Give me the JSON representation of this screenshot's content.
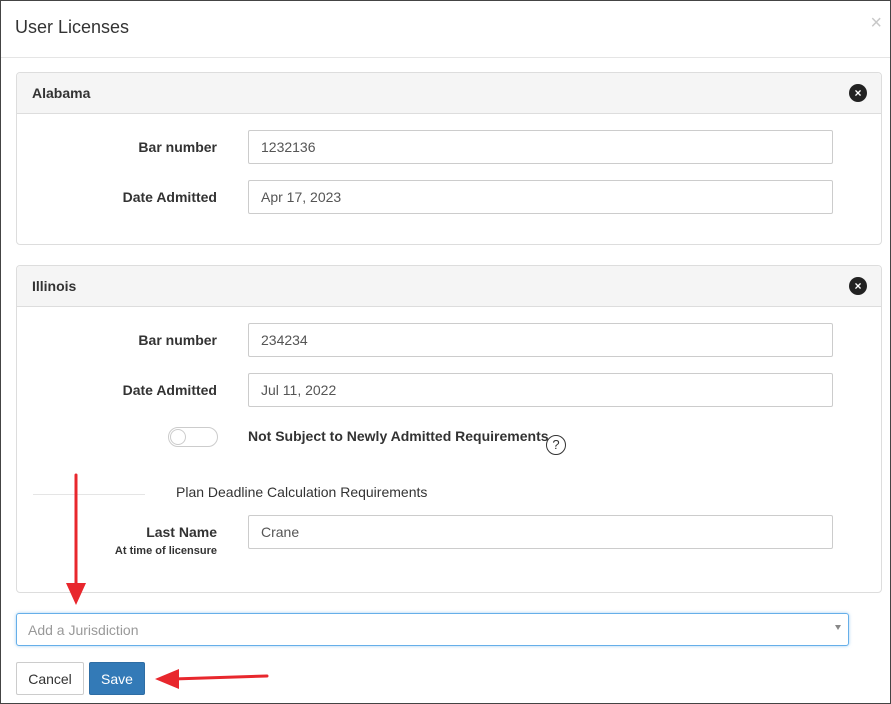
{
  "modal": {
    "title": "User Licenses",
    "close_glyph": "×"
  },
  "licenses": [
    {
      "state": "Alabama",
      "remove_glyph": "×",
      "bar_number_label": "Bar number",
      "bar_number": "1232136",
      "date_admitted_label": "Date Admitted",
      "date_admitted": "Apr 17, 2023"
    },
    {
      "state": "Illinois",
      "remove_glyph": "×",
      "bar_number_label": "Bar number",
      "bar_number": "234234",
      "date_admitted_label": "Date Admitted",
      "date_admitted": "Jul 11, 2022",
      "toggle_label": "Not Subject to Newly Admitted Requirements",
      "toggle_on": false,
      "help_glyph": "?",
      "section_title": "Plan Deadline Calculation Requirements",
      "last_name_label": "Last Name",
      "last_name_sublabel": "At time of licensure",
      "last_name": "Crane"
    }
  ],
  "jurisdiction": {
    "placeholder": "Add a Jurisdiction"
  },
  "footer": {
    "cancel_label": "Cancel",
    "save_label": "Save"
  },
  "colors": {
    "primary": "#337ab7",
    "annotation_arrow": "#e8272d",
    "focus_border": "#66afe9"
  },
  "icons": {
    "close": "close-icon",
    "remove": "remove-circle-icon",
    "help": "question-circle-icon",
    "caret": "chevron-down-icon"
  }
}
